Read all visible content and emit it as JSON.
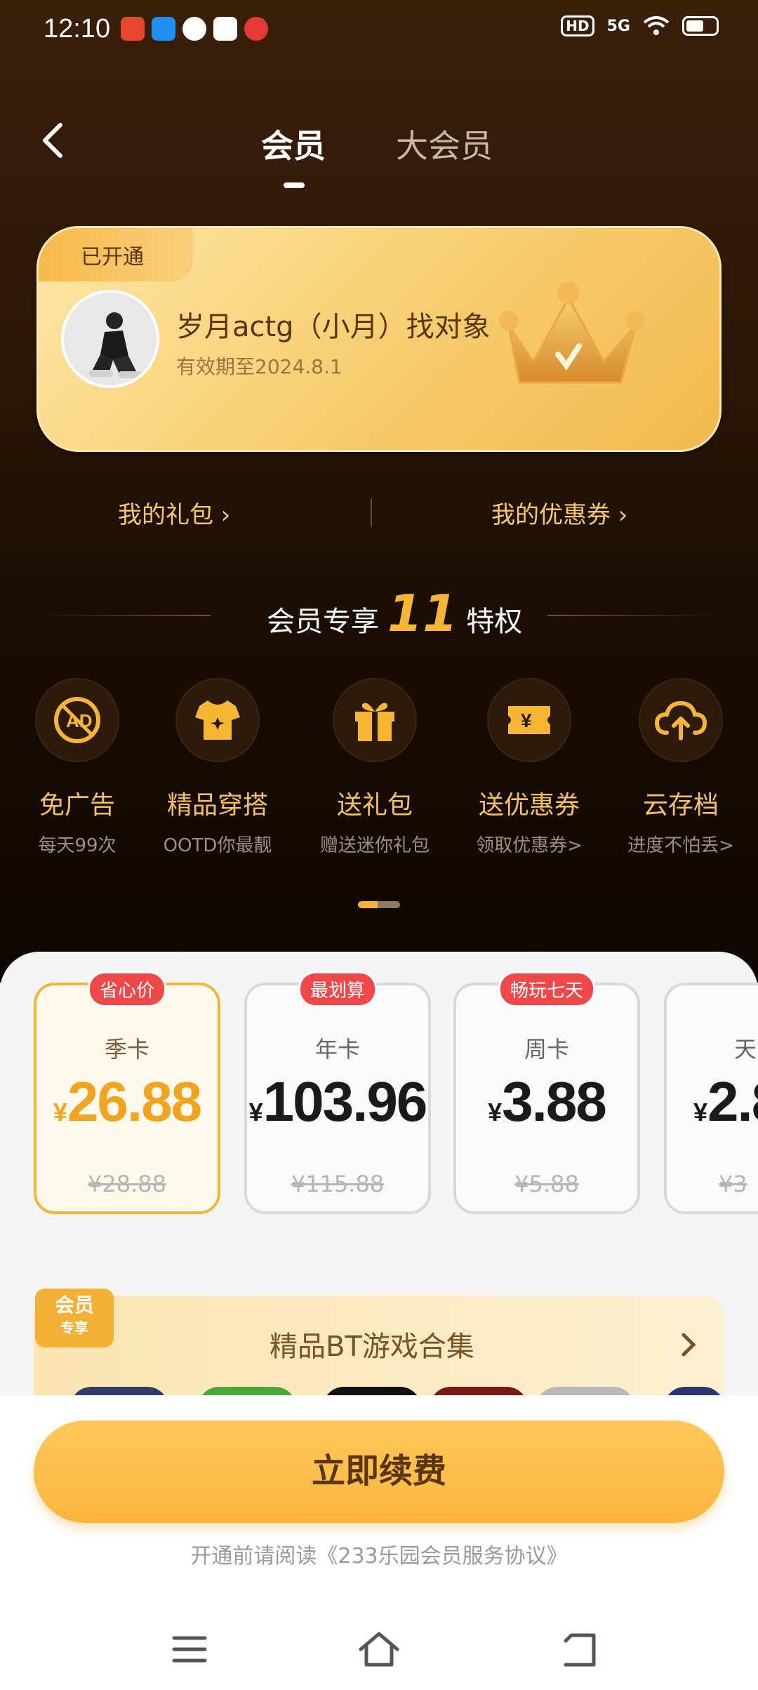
{
  "status_bar": {
    "time": "12:10",
    "hd": "HD",
    "network": "5G"
  },
  "header": {
    "tabs": [
      {
        "label": "会员",
        "active": true
      },
      {
        "label": "大会员",
        "active": false
      }
    ]
  },
  "member_card": {
    "tag": "已开通",
    "username": "岁月actg（小月）找对象",
    "expire": "有效期至2024.8.1"
  },
  "links": {
    "gift": "我的礼包",
    "coupon": "我的优惠券"
  },
  "privileges": {
    "title_prefix": "会员专享",
    "count": "11",
    "title_suffix": "特权",
    "items": [
      {
        "name": "免广告",
        "desc": "每天99次",
        "icon": "no-ads-icon"
      },
      {
        "name": "精品穿搭",
        "desc": "OOTD你最靓",
        "icon": "tshirt-icon"
      },
      {
        "name": "送礼包",
        "desc": "赠送迷你礼包",
        "icon": "gift-icon"
      },
      {
        "name": "送优惠券",
        "desc": "领取优惠券>",
        "icon": "coupon-icon"
      },
      {
        "name": "云存档",
        "desc": "进度不怕丢>",
        "icon": "cloud-upload-icon"
      }
    ]
  },
  "plans": [
    {
      "badge": "省心价",
      "name": "季卡",
      "currency": "¥",
      "price": "26.88",
      "original": "¥28.88",
      "selected": true
    },
    {
      "badge": "最划算",
      "name": "年卡",
      "currency": "¥",
      "price": "103.96",
      "original": "¥115.88",
      "selected": false
    },
    {
      "badge": "畅玩七天",
      "name": "周卡",
      "currency": "¥",
      "price": "3.88",
      "original": "¥5.88",
      "selected": false
    },
    {
      "badge": "",
      "name": "天",
      "currency": "¥",
      "price": "2.8",
      "original": "¥3",
      "selected": false
    }
  ],
  "bt_banner": {
    "tag_line1": "会员",
    "tag_line2": "专享",
    "title": "精品BT游戏合集"
  },
  "footer": {
    "renew_label": "立即续费",
    "agreement": "开通前请阅读《233乐园会员服务协议》"
  },
  "colors": {
    "accent": "#f6b532",
    "button": "#fbb53d",
    "badge_red": "#f04848",
    "header_bg": "#2e1807"
  }
}
